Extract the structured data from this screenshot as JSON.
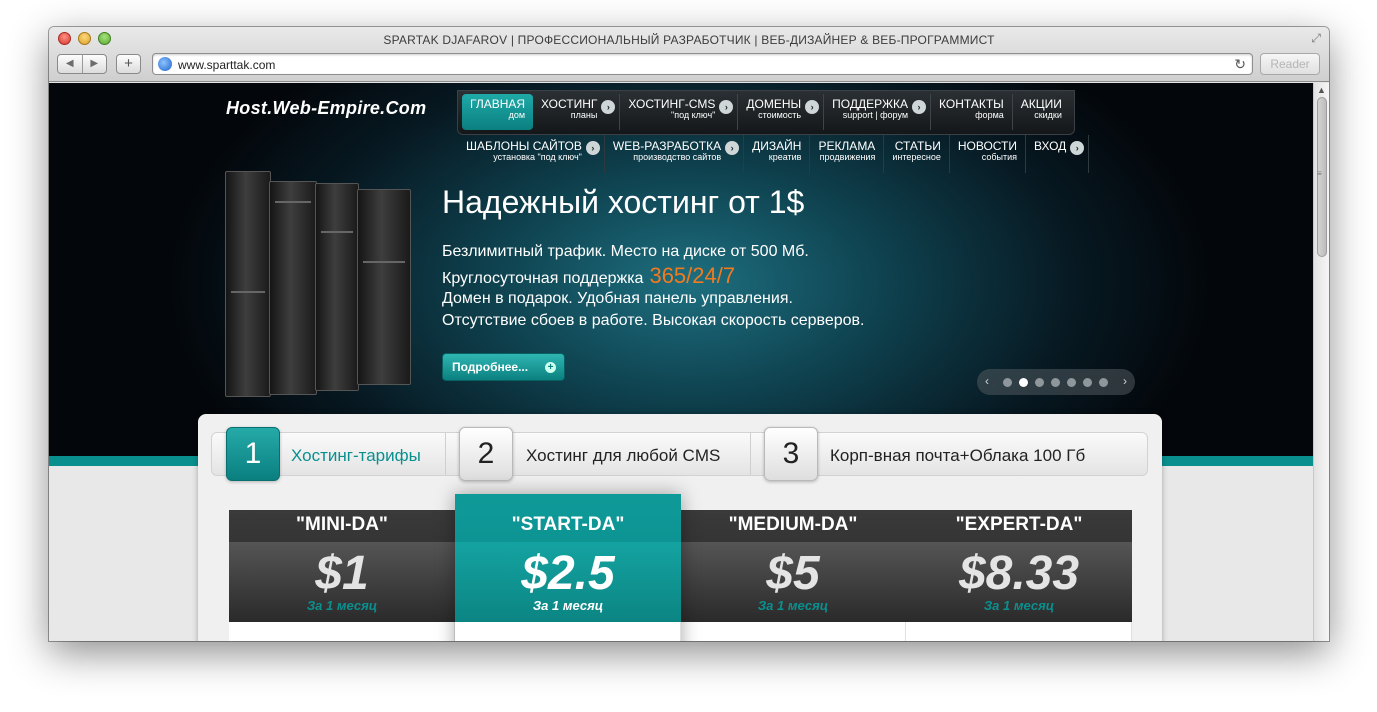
{
  "window": {
    "title": "SPARTAK DJAFAROV | ПРОФЕССИОНАЛЬНЫЙ РАЗРАБОТЧИК | ВЕБ-ДИЗАЙНЕР & ВЕБ-ПРОГРАММИСТ",
    "url": "www.sparttak.com",
    "reader_label": "Reader"
  },
  "site": {
    "logo": "Host.Web-Empire.Com",
    "menu_top": [
      {
        "label": "Главная",
        "sub": "дом",
        "active": true
      },
      {
        "label": "Хостинг",
        "sub": "планы",
        "arrow": true
      },
      {
        "label": "Хостинг-CMS",
        "sub": "\"под ключ\"",
        "arrow": true
      },
      {
        "label": "Домены",
        "sub": "стоимость",
        "arrow": true
      },
      {
        "label": "Поддержка",
        "sub": "support | форум",
        "arrow": true
      },
      {
        "label": "Контакты",
        "sub": "форма"
      },
      {
        "label": "Акции",
        "sub": "скидки"
      }
    ],
    "menu_bottom": [
      {
        "label": "Шаблоны сайтов",
        "sub": "установка \"под ключ\"",
        "arrow": true
      },
      {
        "label": "Web-разработка",
        "sub": "производство сайтов",
        "arrow": true
      },
      {
        "label": "Дизайн",
        "sub": "креатив"
      },
      {
        "label": "Реклама",
        "sub": "продвижения"
      },
      {
        "label": "Статьи",
        "sub": "интересное"
      },
      {
        "label": "Новости",
        "sub": "события"
      },
      {
        "label": "Вход",
        "sub": "",
        "arrow": true
      }
    ],
    "hero": {
      "title": "Надежный хостинг от 1$",
      "line1": "Безлимитный трафик.  Место на диске от 500 Мб.",
      "line2": "Круглосуточная поддержка",
      "line2_accent": "365/24/7",
      "line3": "Домен в подарок.  Удобная панель управления.",
      "line4": "Отсутствие сбоев в работе.  Высокая скорость серверов.",
      "more_button": "Подробнее...",
      "slider_active_index": 1,
      "slider_count": 7
    },
    "tabs": [
      {
        "num": "1",
        "label": "Хостинг-тарифы",
        "active": true
      },
      {
        "num": "2",
        "label": "Хостинг для любой CMS"
      },
      {
        "num": "3",
        "label": "Корп-вная почта+Облака 100 Гб"
      }
    ],
    "plans": [
      {
        "name": "\"MINI-DA\"",
        "price": "$1",
        "period": "За 1 месяц"
      },
      {
        "name": "\"START-DA\"",
        "price": "$2.5",
        "period": "За 1 месяц",
        "featured": true
      },
      {
        "name": "\"MEDIUM-DA\"",
        "price": "$5",
        "period": "За 1 месяц"
      },
      {
        "name": "\"EXPERT-DA\"",
        "price": "$8.33",
        "period": "За 1 месяц"
      }
    ]
  },
  "colors": {
    "accent": "#0a8f8f",
    "orange": "#f27a1e"
  }
}
